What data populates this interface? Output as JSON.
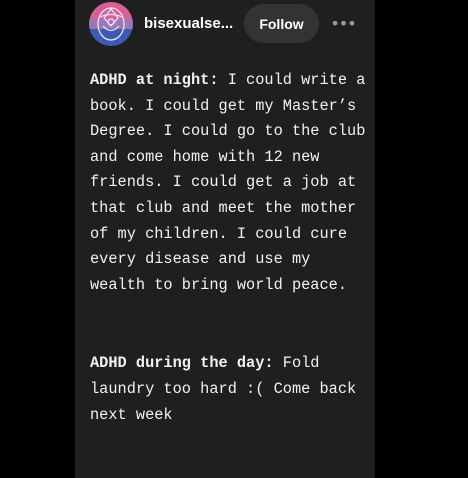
{
  "post": {
    "username": "bisexualse...",
    "follow_label": "Follow",
    "more_label": "•••",
    "paragraphs": [
      {
        "heading": "ADHD at night:",
        "text": " I could write a book. I could get my Master’s Degree. I could go to the club and come home with 12 new friends. I could get a job at that club and meet the mother of my children. I could cure every disease and use my wealth to bring world peace."
      },
      {
        "heading": "ADHD during the day:",
        "text": " Fold laundry too hard :( Come back next week"
      }
    ]
  },
  "colors": {
    "background": "#000000",
    "card": "#1f1f1f",
    "button": "#333333",
    "text": "#f2f2f2",
    "avatar_pink": "#d6619a",
    "avatar_purple": "#9b78b8",
    "avatar_blue": "#3b5bb5"
  },
  "icons": {
    "avatar": "bisexual-flag-avatar",
    "more": "ellipsis-icon"
  }
}
